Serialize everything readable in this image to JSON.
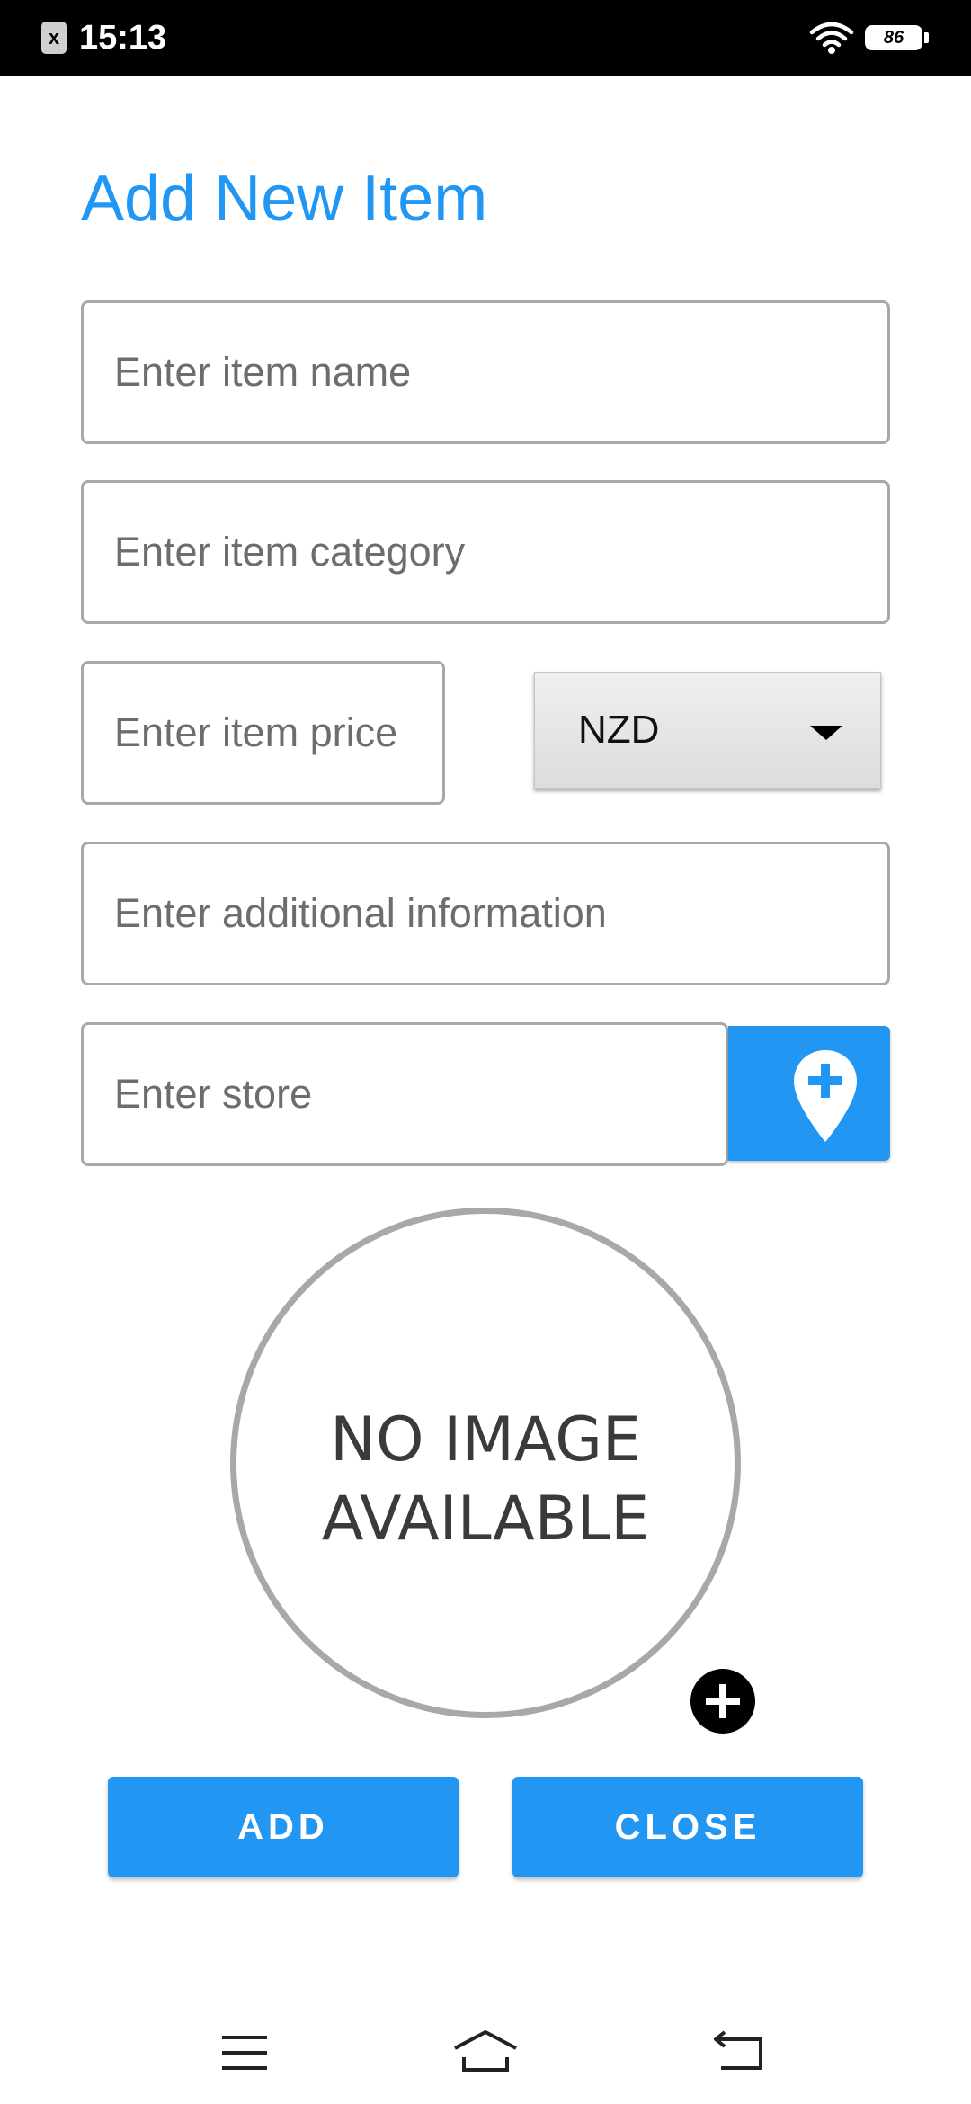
{
  "status_bar": {
    "time": "15:13",
    "battery_level": "86",
    "notification_icon": "x",
    "icons": [
      "notification-icon",
      "wifi-icon",
      "battery-icon"
    ]
  },
  "page": {
    "title": "Add New Item",
    "accent_color": "#2196f3"
  },
  "form": {
    "name": {
      "placeholder": "Enter item name",
      "value": ""
    },
    "category": {
      "placeholder": "Enter item category",
      "value": ""
    },
    "price": {
      "placeholder": "Enter item price",
      "value": ""
    },
    "currency": {
      "selected": "NZD",
      "icon": "caret-down-icon"
    },
    "additional_info": {
      "placeholder": "Enter additional information",
      "value": ""
    },
    "store": {
      "placeholder": "Enter store",
      "value": ""
    },
    "store_location_button": {
      "icon": "add-location-icon"
    }
  },
  "image": {
    "placeholder_line1": "NO IMAGE",
    "placeholder_line2": "AVAILABLE",
    "add_image_icon": "add-circle-icon"
  },
  "actions": {
    "add_label": "ADD",
    "close_label": "CLOSE"
  },
  "nav_bar": {
    "icons": [
      "menu-icon",
      "home-icon",
      "back-icon"
    ]
  }
}
